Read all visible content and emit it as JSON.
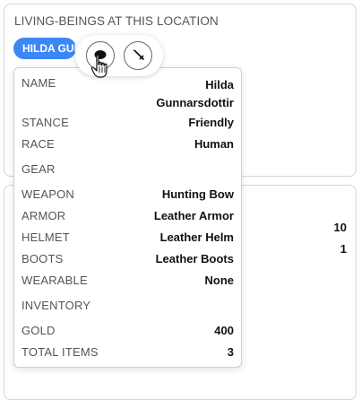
{
  "location": {
    "title": "LIVING-BEINGS AT THIS LOCATION",
    "chip_label": "HILDA GUNNARSDOTTIR"
  },
  "background": {
    "values": [
      "10",
      "1"
    ]
  },
  "actions": {
    "talk_icon": "speech-bubble-icon",
    "attack_icon": "sword-icon"
  },
  "details": {
    "name_label": "NAME",
    "name_value_line1": "Hilda",
    "name_value_line2": "Gunnarsdottir",
    "stance_label": "STANCE",
    "stance_value": "Friendly",
    "race_label": "RACE",
    "race_value": "Human",
    "gear_label": "GEAR",
    "weapon_label": "WEAPON",
    "weapon_value": "Hunting Bow",
    "armor_label": "ARMOR",
    "armor_value": "Leather Armor",
    "helmet_label": "HELMET",
    "helmet_value": "Leather Helm",
    "boots_label": "BOOTS",
    "boots_value": "Leather Boots",
    "wearable_label": "WEARABLE",
    "wearable_value": "None",
    "inventory_label": "INVENTORY",
    "gold_label": "GOLD",
    "gold_value": "400",
    "total_items_label": "TOTAL ITEMS",
    "total_items_value": "3"
  },
  "colors": {
    "chip": "#3d87f5"
  }
}
